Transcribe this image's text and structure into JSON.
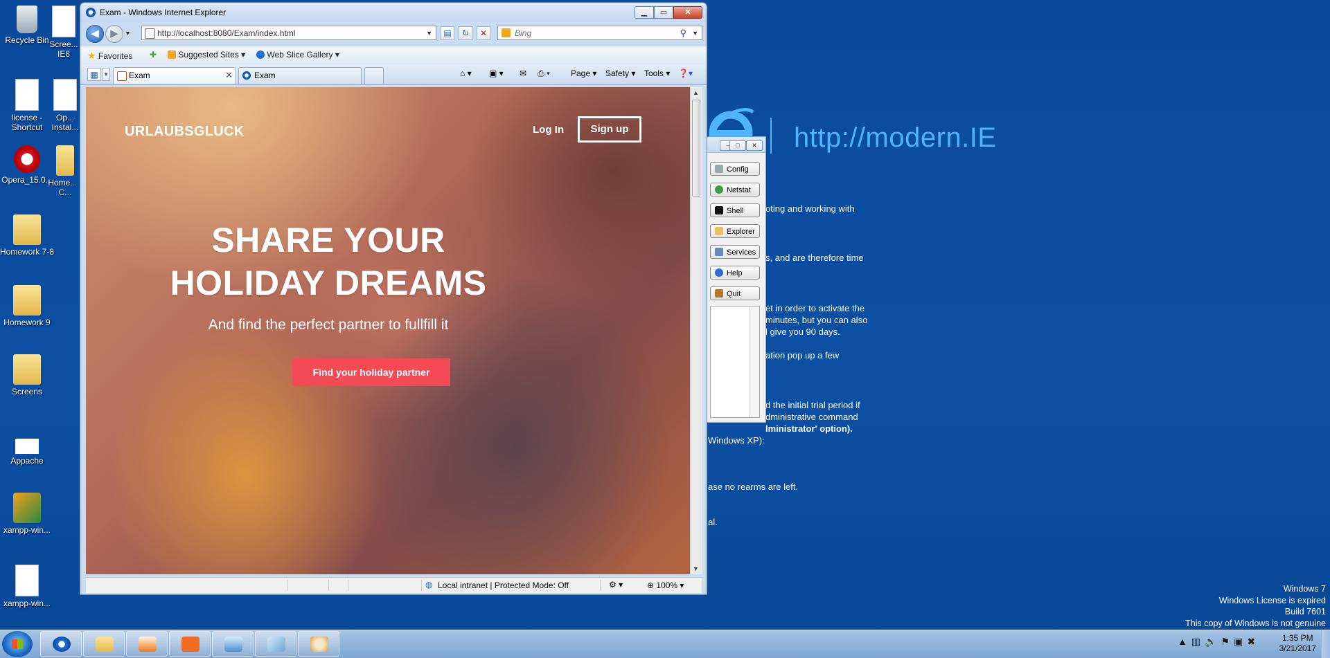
{
  "desktop": {
    "icons": [
      {
        "label": "Recycle Bin"
      },
      {
        "label": "Scree... IE8"
      },
      {
        "label": "license - Shortcut"
      },
      {
        "label": "Op... Instal..."
      },
      {
        "label": "Opera_15.0..."
      },
      {
        "label": "Home... - C..."
      },
      {
        "label": "Homework 7-8"
      },
      {
        "label": "Homework 9"
      },
      {
        "label": "Screens"
      },
      {
        "label": "Appache"
      },
      {
        "label": "xampp-win..."
      },
      {
        "label": "xampp-win..."
      }
    ],
    "modern_ie": {
      "url": "http://modern.IE"
    },
    "background_text": [
      "oting and working with",
      "s, and are therefore time",
      "et in order to activate the",
      "minutes, but you can also",
      "l give you 90 days.",
      "ation pop up a few",
      "d the initial trial period if",
      "dministrative command",
      "lministrator' option).",
      "Windows XP):",
      "ase no rearms are left.",
      "al."
    ],
    "windows_info": {
      "line1": "Windows 7",
      "line2": "Windows License is expired",
      "line3": "Build 7601",
      "line4": "This copy of Windows is not genuine"
    }
  },
  "side_panel": {
    "buttons": [
      {
        "label": "Config"
      },
      {
        "label": "Netstat"
      },
      {
        "label": "Shell"
      },
      {
        "label": "Explorer"
      },
      {
        "label": "Services"
      },
      {
        "label": "Help"
      },
      {
        "label": "Quit"
      }
    ]
  },
  "browser": {
    "title": "Exam - Windows Internet Explorer",
    "address": "http://localhost:8080/Exam/index.html",
    "search_placeholder": "Bing",
    "favorites": {
      "favorites_label": "Favorites",
      "suggested_sites": "Suggested Sites",
      "web_slice_gallery": "Web Slice Gallery"
    },
    "tabs": [
      {
        "label": "Exam",
        "active": true
      },
      {
        "label": "Exam",
        "active": false
      }
    ],
    "toolbar": {
      "page": "Page",
      "safety": "Safety",
      "tools": "Tools"
    },
    "status": {
      "zone": "Local intranet | Protected Mode: Off",
      "zoom": "100%"
    }
  },
  "page": {
    "brand": "URLAUBSGLUCK",
    "login": "Log In",
    "signup": "Sign up",
    "hero_line1": "SHARE YOUR",
    "hero_line2": "HOLIDAY DREAMS",
    "subtitle": "And find the perfect partner to fullfill it",
    "cta": "Find your holiday partner"
  },
  "taskbar": {
    "time": "1:35 PM",
    "date": "3/21/2017"
  },
  "colors": {
    "desktop": "#0b4fa3",
    "modern_accent": "#4fb3ff",
    "cta": "#f34a55"
  }
}
